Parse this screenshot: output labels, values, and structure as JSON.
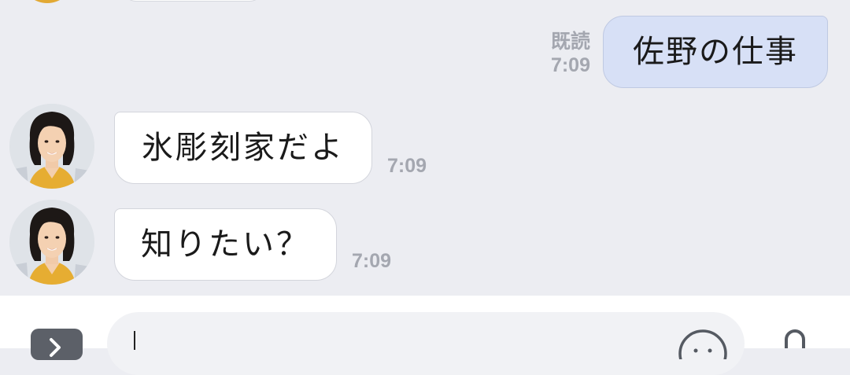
{
  "messages": [
    {
      "direction": "outgoing",
      "text": "佐野の仕事",
      "read_label": "既読",
      "time": "7:09"
    },
    {
      "direction": "incoming",
      "text": "氷彫刻家だよ",
      "time": "7:09"
    },
    {
      "direction": "incoming",
      "text": "知りたい？",
      "time": "7:09"
    }
  ],
  "input": {
    "placeholder": "",
    "value": ""
  },
  "icons": {
    "expand": "chevron-right-icon",
    "emoji": "smiley-icon",
    "mic": "microphone-icon"
  },
  "colors": {
    "background": "#ecedf2",
    "outgoing_bubble": "#d7e0f6",
    "incoming_bubble": "#ffffff",
    "meta_text": "#a4a7b0"
  }
}
